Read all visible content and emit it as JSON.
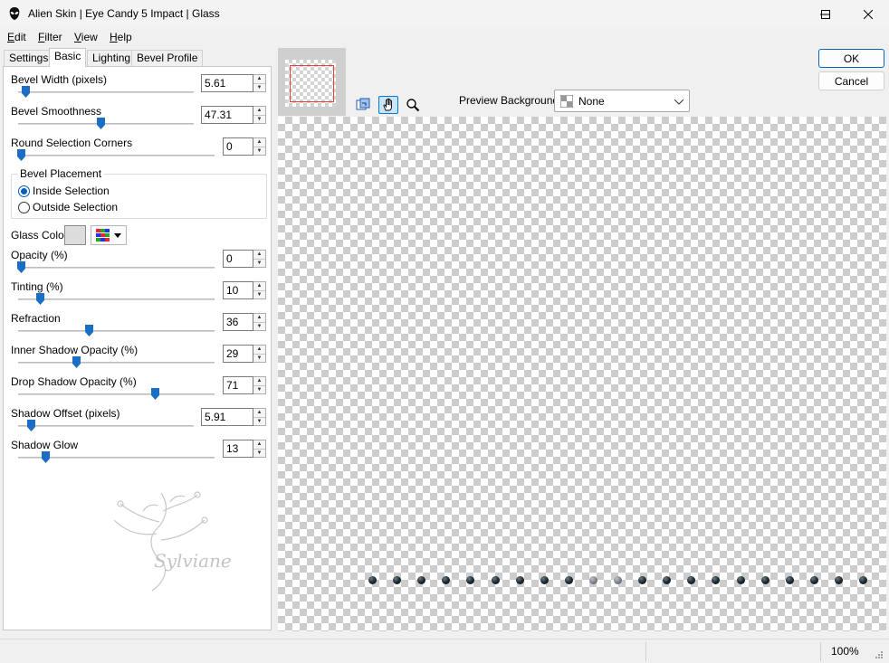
{
  "window": {
    "title": "Alien Skin | Eye Candy 5 Impact | Glass"
  },
  "menu": {
    "items": [
      {
        "label": "Edit",
        "mnemonic": "E",
        "rest": "dit"
      },
      {
        "label": "Filter",
        "mnemonic": "F",
        "rest": "ilter"
      },
      {
        "label": "View",
        "mnemonic": "V",
        "rest": "iew"
      },
      {
        "label": "Help",
        "mnemonic": "H",
        "rest": "elp"
      }
    ]
  },
  "tabs": [
    "Settings",
    "Basic",
    "Lighting",
    "Bevel Profile"
  ],
  "active_tab": "Basic",
  "controls": {
    "bevel_width": {
      "label": "Bevel Width (pixels)",
      "value": "5.61",
      "slider_fraction": 0.05
    },
    "bevel_smoothness": {
      "label": "Bevel Smoothness",
      "value": "47.31",
      "slider_fraction": 0.47
    },
    "round_corners": {
      "label": "Round Selection Corners",
      "value": "0",
      "slider_fraction": 0.0
    },
    "bevel_placement": {
      "label": "Bevel Placement",
      "options": [
        "Inside Selection",
        "Outside Selection"
      ],
      "selected": "Inside Selection"
    },
    "glass_color": {
      "label": "Glass Color",
      "color": "#dcdcdc"
    },
    "opacity": {
      "label": "Opacity (%)",
      "value": "0",
      "slider_fraction": 0.0
    },
    "tinting": {
      "label": "Tinting (%)",
      "value": "10",
      "slider_fraction": 0.1
    },
    "refraction": {
      "label": "Refraction",
      "value": "36",
      "slider_fraction": 0.36
    },
    "inner_shadow_opacity": {
      "label": "Inner Shadow Opacity (%)",
      "value": "29",
      "slider_fraction": 0.29
    },
    "drop_shadow_opacity": {
      "label": "Drop Shadow Opacity (%)",
      "value": "71",
      "slider_fraction": 0.71
    },
    "shadow_offset": {
      "label": "Shadow Offset (pixels)",
      "value": "5.91",
      "slider_fraction": 0.08
    },
    "shadow_glow": {
      "label": "Shadow Glow",
      "value": "13",
      "slider_fraction": 0.13
    }
  },
  "watermark_text": "Sylviane",
  "preview": {
    "background_label": "Preview Background:",
    "background_value": "None"
  },
  "buttons": {
    "ok": "OK",
    "cancel": "Cancel"
  },
  "status": {
    "zoom": "100%"
  },
  "colors": {
    "accent": "#0067c0",
    "thumb": "#1a6fc4"
  }
}
